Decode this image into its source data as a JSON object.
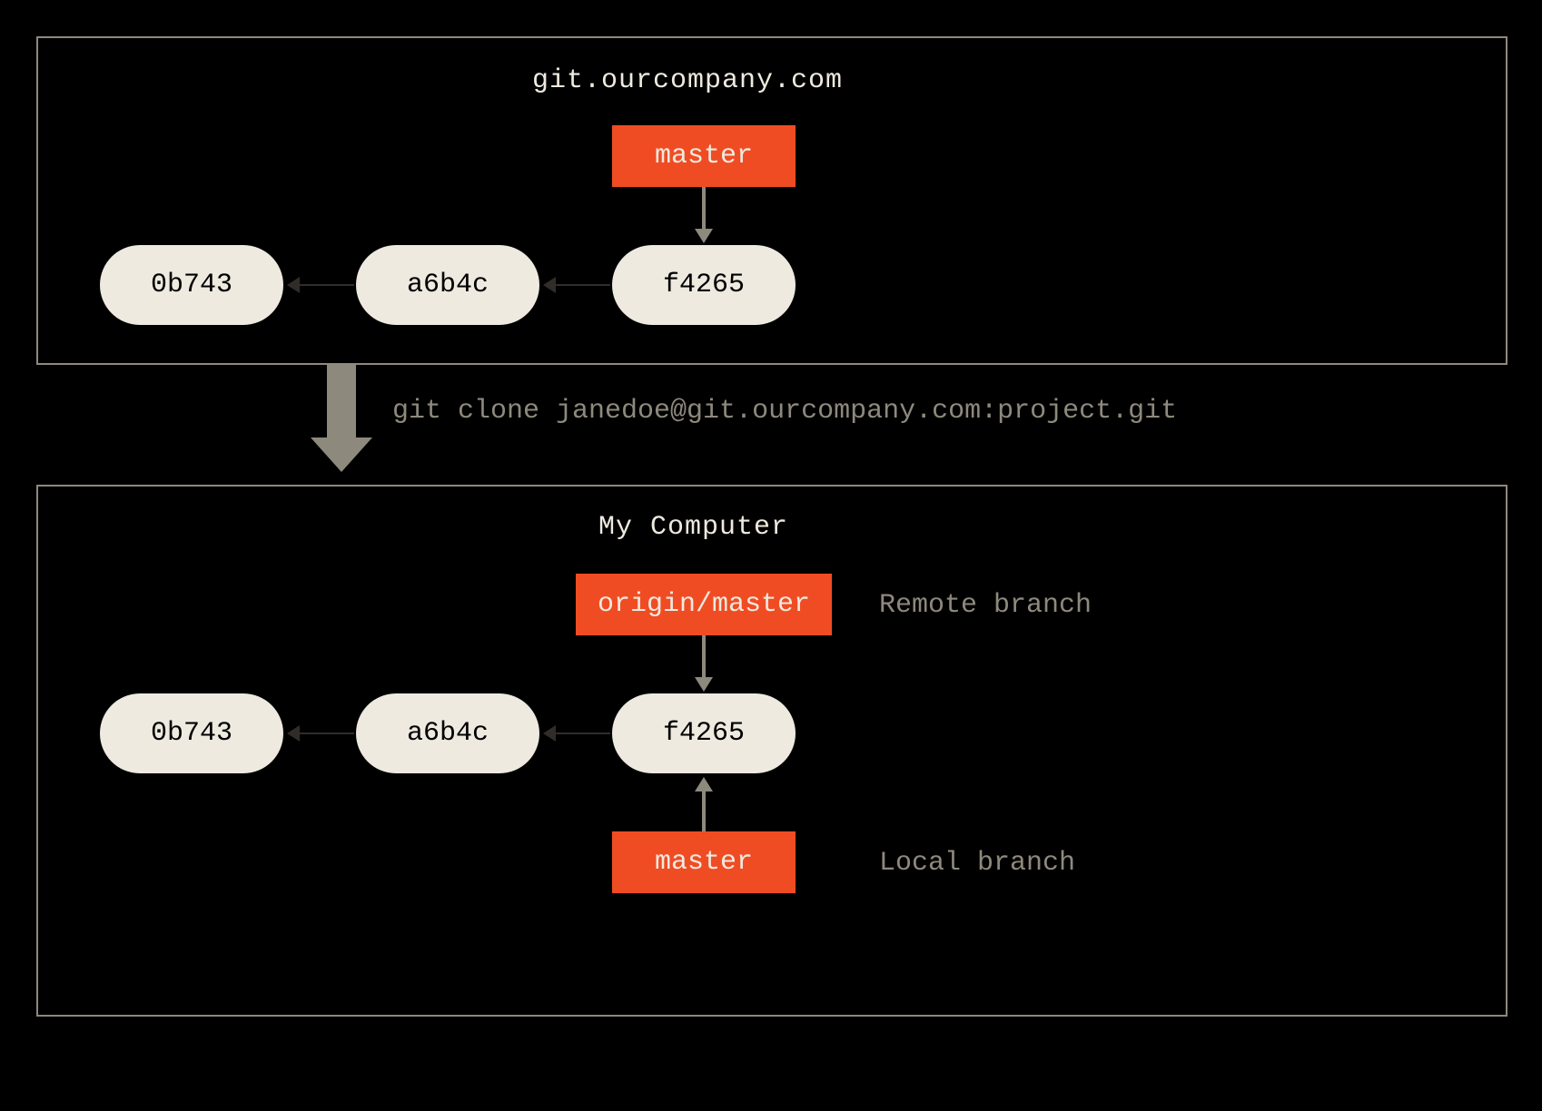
{
  "remote": {
    "title": "git.ourcompany.com",
    "branches": [
      {
        "name": "master"
      }
    ],
    "commits": [
      "0b743",
      "a6b4c",
      "f4265"
    ]
  },
  "clone_command": "git clone janedoe@git.ourcompany.com:project.git",
  "local": {
    "title": "My Computer",
    "remote_tracking_branch": {
      "name": "origin/master",
      "label": "Remote branch"
    },
    "local_branch": {
      "name": "master",
      "label": "Local branch"
    },
    "commits": [
      "0b743",
      "a6b4c",
      "f4265"
    ]
  },
  "colors": {
    "bg": "#000000",
    "panel_border": "#8e897d",
    "commit_fill": "#eeeae0",
    "branch_fill": "#f04c23",
    "muted_text": "#8e897d",
    "title_text": "#eeeae0"
  }
}
